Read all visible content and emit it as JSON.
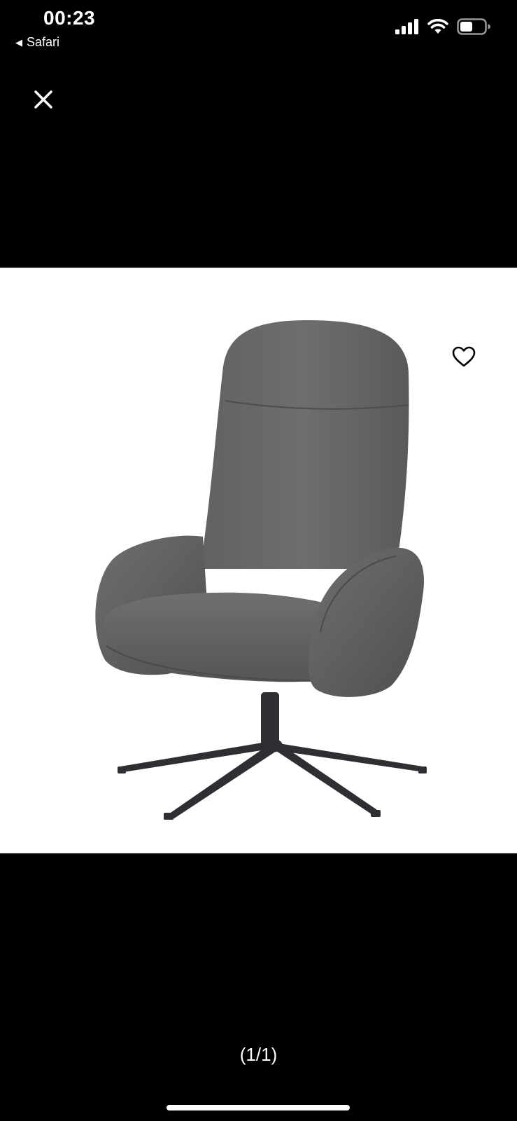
{
  "status_bar": {
    "time": "00:23",
    "back_app": "Safari",
    "back_icon": "back-triangle-icon",
    "signal_icon": "cellular-signal-icon",
    "wifi_icon": "wifi-icon",
    "battery_icon": "battery-icon",
    "battery_level": 0.5
  },
  "viewer": {
    "close_icon": "close-icon",
    "favorite_icon": "heart-outline-icon",
    "image_subject": "swivel armchair, grey upholstery, black four-star base",
    "page_counter": "(1/1)",
    "background": "#000000",
    "image_background": "#ffffff"
  }
}
